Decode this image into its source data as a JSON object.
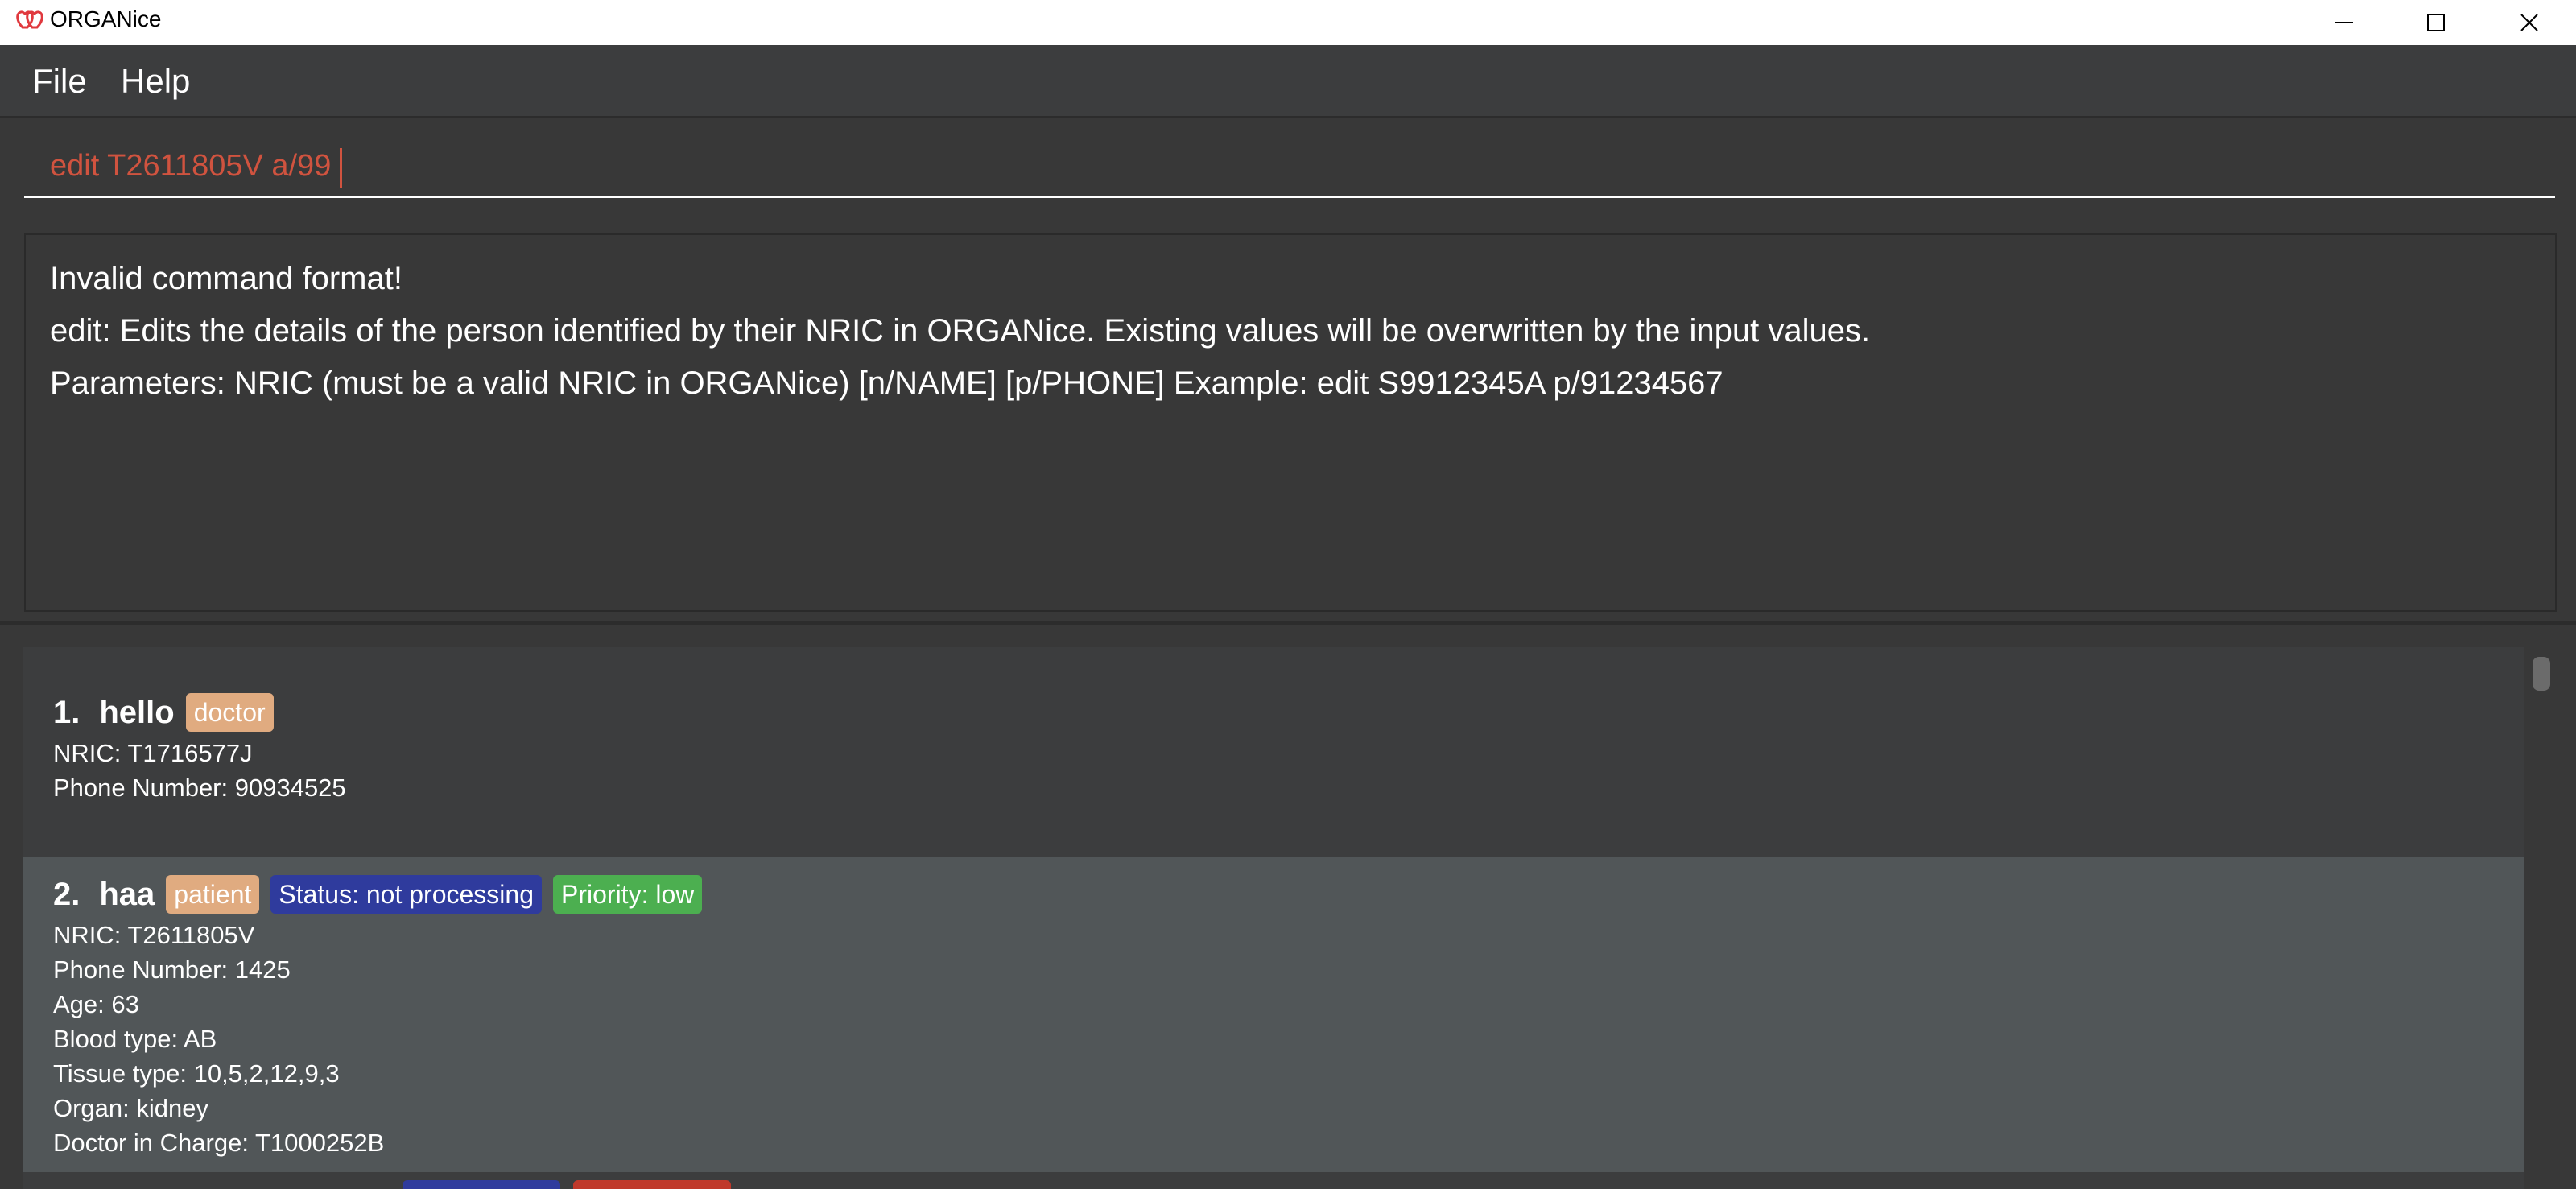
{
  "window": {
    "title": "ORGANice",
    "icon": "hearts-icon",
    "controls": [
      "minimize-icon",
      "maximize-icon",
      "close-icon"
    ]
  },
  "menu": {
    "file": "File",
    "help": "Help"
  },
  "command_box": {
    "value": "edit T2611805V a/99",
    "text_color": "#d0533f"
  },
  "result": {
    "lines": [
      "Invalid command format!",
      "edit: Edits the details of the person identified by their NRIC in ORGANice. Existing values will be overwritten by the input values.",
      "Parameters: NRIC (must be a valid NRIC in ORGANice) [n/NAME] [p/PHONE] Example: edit S9912345A p/91234567"
    ]
  },
  "persons": [
    {
      "index": "1.",
      "name": "hello",
      "tags": [
        {
          "label": "doctor",
          "color": "#e0ab80"
        }
      ],
      "fields": [
        "NRIC: T1716577J",
        "Phone Number: 90934525"
      ]
    },
    {
      "index": "2.",
      "name": "haa",
      "tags": [
        {
          "label": "patient",
          "color": "#e0ab80"
        },
        {
          "label": "Status: not processing",
          "color": "#2f3b9d"
        },
        {
          "label": "Priority: low",
          "color": "#4caf50"
        }
      ],
      "fields": [
        "NRIC: T2611805V",
        "Phone Number: 1425",
        "Age: 63",
        "Blood type: AB",
        "Tissue type: 10,5,2,12,9,3",
        "Organ: kidney",
        "Doctor in Charge: T1000252B"
      ]
    }
  ],
  "colors": {
    "background": "#383838",
    "card_default": "#3c3d3e",
    "card_selected": "#515658",
    "tag_role": "#e0ab80",
    "tag_status": "#2f3b9d",
    "tag_priority": "#4caf50"
  }
}
